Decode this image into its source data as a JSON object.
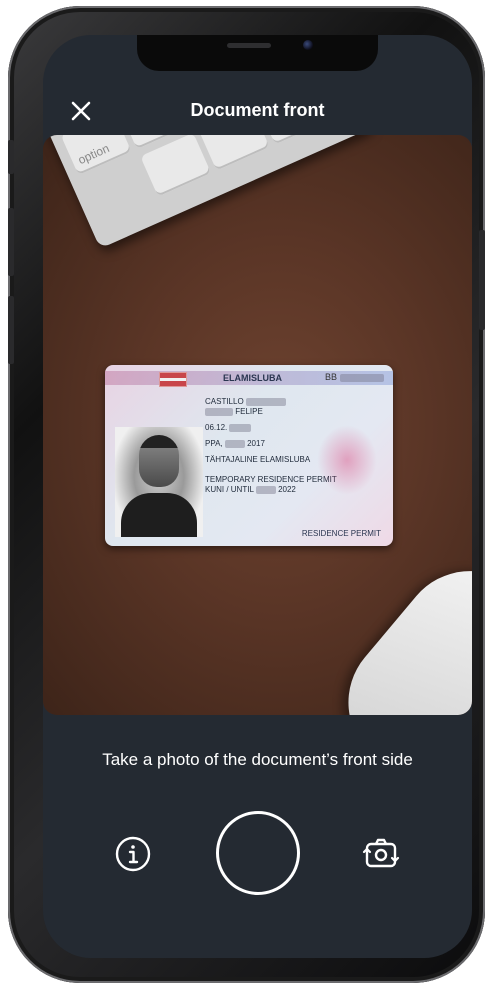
{
  "header": {
    "title": "Document front",
    "close_icon": "close-icon"
  },
  "viewfinder": {
    "id_card": {
      "issuer": "ELAMISLUBA",
      "document_code": "BB",
      "surname": "CASTILLO",
      "given_name": "FELIPE",
      "birth_date": "06.12.",
      "issue_place_prefix": "PPA,",
      "issue_year": "2017",
      "permit_type": "TÄHTAJALINE ELAMISLUBA",
      "remarks_line1": "TEMPORARY RESIDENCE PERMIT",
      "valid_until_label": "KUNI / UNTIL",
      "valid_until_year": "2022",
      "document_type": "RESIDENCE PERMIT"
    },
    "keyboard_key_label": "option"
  },
  "instruction": "Take a photo of the document’s front side",
  "controls": {
    "info_icon": "info-icon",
    "shutter_icon": "shutter-button",
    "flip_icon": "flip-camera-icon"
  },
  "colors": {
    "background": "#242a32",
    "text": "#ffffff"
  }
}
